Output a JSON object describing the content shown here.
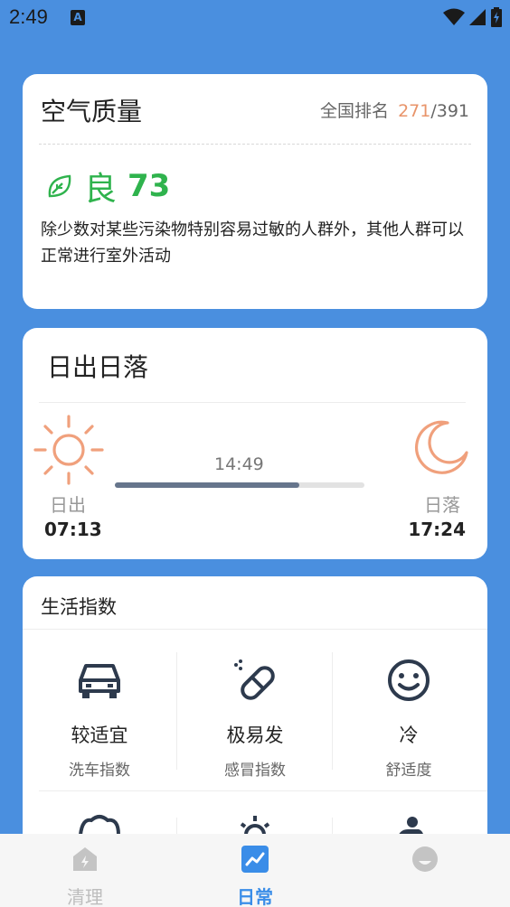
{
  "status": {
    "time": "2:49",
    "notif_letter": "A"
  },
  "air": {
    "title": "空气质量",
    "rank_label": "全国排名",
    "rank_value": "271",
    "rank_total": "/391",
    "level": "良",
    "aqi": "73",
    "description": "除少数对某些污染物特别容易过敏的人群外，其他人群可以正常进行室外活动",
    "colors": {
      "good": "#2fb34d",
      "rank": "#e8946a"
    }
  },
  "sun": {
    "title": "日出日落",
    "now": "14:49",
    "sunrise_label": "日出",
    "sunrise_time": "07:13",
    "sunset_label": "日落",
    "sunset_time": "17:24",
    "progress": 0.74
  },
  "life": {
    "title": "生活指数",
    "items": [
      {
        "value": "较适宜",
        "name": "洗车指数",
        "icon": "car-icon"
      },
      {
        "value": "极易发",
        "name": "感冒指数",
        "icon": "pill-icon"
      },
      {
        "value": "冷",
        "name": "舒适度",
        "icon": "smile-icon"
      }
    ]
  },
  "nav": {
    "items": [
      {
        "label": "清理",
        "icon": "clean-icon",
        "active": false
      },
      {
        "label": "日常",
        "icon": "daily-chart-icon",
        "active": true
      },
      {
        "label": "",
        "icon": "face-icon",
        "active": false
      }
    ],
    "active_color": "#3a8de8",
    "inactive_color": "#bdbdbd"
  }
}
